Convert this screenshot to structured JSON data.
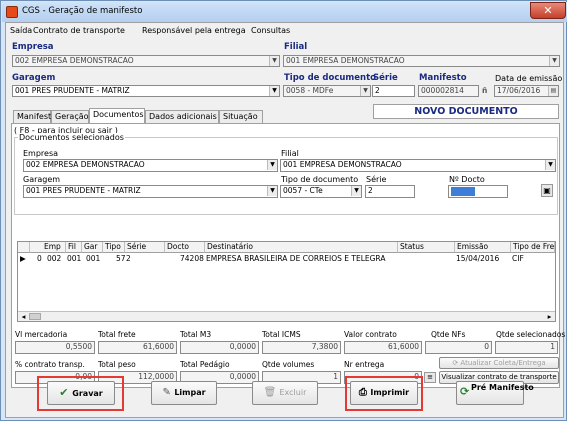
{
  "window": {
    "title": "CGS - Geração de manifesto",
    "close": "✕"
  },
  "menu": [
    "Saída",
    "Contrato de transporte",
    "Responsável pela entrega",
    "Consultas"
  ],
  "header": {
    "empresa_label": "Empresa",
    "empresa_value": "002 EMPRESA DEMONSTRACAO",
    "filial_label": "Filial",
    "filial_value": "001 EMPRESA DEMONSTRACAO",
    "garagem_label": "Garagem",
    "garagem_value": "001 PRES PRUDENTE - MATRIZ",
    "tipo_doc_label": "Tipo de documento",
    "tipo_doc_value": "0058 - MDFe",
    "serie_label": "Série",
    "serie_value": "2",
    "manifesto_label": "Manifesto",
    "manifesto_value": "000002814",
    "data_emissao_label": "Data de emissão",
    "data_emissao_value": "17/06/2016"
  },
  "tabs": [
    "Manifesto",
    "Geração",
    "Documentos",
    "Dados adicionais",
    "Situação"
  ],
  "novo_documento": "NOVO DOCUMENTO",
  "panel": {
    "hint": "( F8 - para incluir ou sair )",
    "group_title": "Documentos selecionados",
    "empresa_label": "Empresa",
    "empresa_value": "002 EMPRESA DEMONSTRACAO",
    "filial_label": "Filial",
    "filial_value": "001 EMPRESA DEMONSTRACAO",
    "garagem_label": "Garagem",
    "garagem_value": "001 PRES PRUDENTE - MATRIZ",
    "tipo_doc_label": "Tipo de documento",
    "tipo_doc_value": "0057 - CTe",
    "serie_label": "Série",
    "serie_value": "2",
    "nro_label": "Nº Docto"
  },
  "grid": {
    "columns": [
      "Emp",
      "Fil",
      "Gar",
      "Tipo",
      "Série",
      "Docto",
      "Destinatário",
      "Status",
      "Emissão",
      "Tipo de Fre"
    ],
    "rows": [
      {
        "marker": "▶",
        "idx": "0",
        "emp": "002",
        "fil": "001",
        "gar": "001",
        "tipo": "57",
        "serie": "2",
        "docto": "74208",
        "destinatario": "EMPRESA BRASILEIRA DE CORREIOS E TELEGRA",
        "status": "",
        "emissao": "15/04/2016",
        "tipo_frete": "CIF"
      }
    ]
  },
  "totals": {
    "vl_mercadoria_label": "Vl mercadoria",
    "vl_mercadoria": "0,5500",
    "total_frete_label": "Total frete",
    "total_frete": "61,6000",
    "total_m3_label": "Total M3",
    "total_m3": "0,0000",
    "total_icms_label": "Total ICMS",
    "total_icms": "7,3800",
    "valor_contrato_label": "Valor contrato",
    "valor_contrato": "61,6000",
    "qtde_nfs_label": "Qtde NFs",
    "qtde_nfs": "0",
    "qtde_selecionados_label": "Qtde selecionados",
    "qtde_selecionados": "1",
    "pct_contrato_label": "% contrato transp.",
    "pct_contrato": "0,00",
    "total_peso_label": "Total peso",
    "total_peso": "112,0000",
    "total_pedagio_label": "Total Pedágio",
    "total_pedagio": "0,0000",
    "qtde_volumes_label": "Qtde volumes",
    "qtde_volumes": "1",
    "nr_entrega_label": "Nr entrega",
    "nr_entrega": "0",
    "atualizar_label": "Atualizar Coleta/Entrega",
    "visualizar_label": "Visualizar contrato de transporte"
  },
  "buttons": {
    "gravar": "Gravar",
    "limpar": "Limpar",
    "excluir": "Excluir",
    "imprimir": "Imprimir",
    "pre_manifesto": "Pré Manifesto"
  },
  "colors": {
    "highlight": "#e53935",
    "label_blue": "#1a2a80",
    "novo_doc": "#1a2a80"
  }
}
